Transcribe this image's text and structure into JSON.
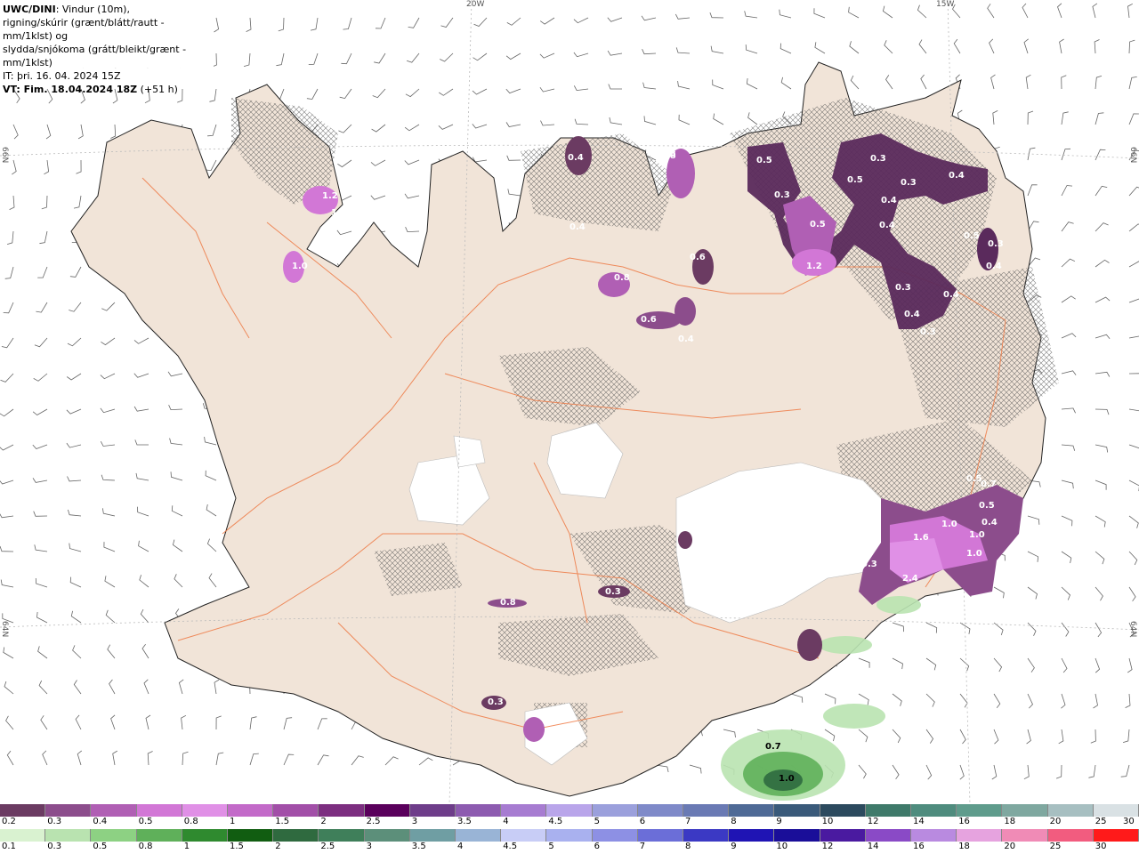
{
  "header": {
    "title_bold": "UWC/DINI",
    "title_rest": ": Vindur (10m),",
    "line2": "rigning/skúrir (grænt/blátt/rautt - mm/1klst) og",
    "line3": "slydda/snjókoma (grátt/bleikt/grænt - mm/1klst)",
    "line4": "IT: þri. 16. 04. 2024 15Z",
    "line5_bold": "VT: Fim. 18.04.2024 18Z",
    "line5_rest": " (+51 h)"
  },
  "graticule": {
    "lon_top": [
      "20W",
      "15W"
    ],
    "lat_left": [
      "66N",
      "64N"
    ],
    "lat_right": [
      "66N",
      "64N"
    ]
  },
  "precip_labels": [
    "0.4",
    "0.8",
    "0.5",
    "0.3",
    "0.4",
    "0.5",
    "0.3",
    "0.3",
    "0.5",
    "0.4",
    "0.4",
    "0.5",
    "0.4",
    "0.3",
    "0.4",
    "0.4",
    "0.3",
    "0.4",
    "0.3",
    "1.2",
    "1.2",
    "1.0",
    "1.2",
    "0.8",
    "0.6",
    "0.6",
    "0.8",
    "0.4",
    "0.5",
    "0.7",
    "0.5",
    "1.0",
    "0.4",
    "1.0",
    "1.6",
    "2.4",
    "1.0",
    "0.3",
    "0.3",
    "0.3",
    "0.8",
    "0.7",
    "1.0"
  ],
  "legend": {
    "row1": {
      "colors": [
        "#6b3b62",
        "#8c4d8c",
        "#b05fb4",
        "#d277d6",
        "#e090e6",
        "#c36ac9",
        "#a24fa8",
        "#7c2e80",
        "#5a005c",
        "#6e3d8a",
        "#8d5bb0",
        "#a77cd1",
        "#b9a5ea",
        "#9ba0dc",
        "#7f8ac9",
        "#6a7ab4",
        "#4f6a96",
        "#3a5a7a",
        "#2c4a5e",
        "#3f7a6a",
        "#4f8c7e",
        "#5f9c8c",
        "#7fa8a0",
        "#a7bfc1",
        "#d9e1e4"
      ],
      "labels": [
        "0.2",
        "0.3",
        "0.4",
        "0.5",
        "0.8",
        "1",
        "1.5",
        "2",
        "2.5",
        "3",
        "3.5",
        "4",
        "4.5",
        "5",
        "6",
        "7",
        "8",
        "9",
        "10",
        "12",
        "14",
        "16",
        "18",
        "20",
        "25",
        "30"
      ]
    },
    "row2": {
      "colors": [
        "#d9f2d0",
        "#b9e3b0",
        "#8dd183",
        "#5fb05a",
        "#2f8a2f",
        "#115d11",
        "#2f6a3f",
        "#3f7f5a",
        "#5c8f7a",
        "#6f9ea3",
        "#99b4d6",
        "#c8cdf6",
        "#a9b1ef",
        "#8d90e4",
        "#6b6ed8",
        "#3b39c4",
        "#1f14b4",
        "#1a0e99",
        "#4a1aa0",
        "#8a4ac6",
        "#b98ae0",
        "#e6a3df",
        "#f08bb6",
        "#f25c7f",
        "#ff1a1a"
      ],
      "labels": [
        "0.1",
        "0.3",
        "0.5",
        "0.8",
        "1",
        "1.5",
        "2",
        "2.5",
        "3",
        "3.5",
        "4",
        "4.5",
        "5",
        "6",
        "7",
        "8",
        "9",
        "10",
        "12",
        "14",
        "16",
        "18",
        "20",
        "25",
        "30"
      ]
    }
  }
}
